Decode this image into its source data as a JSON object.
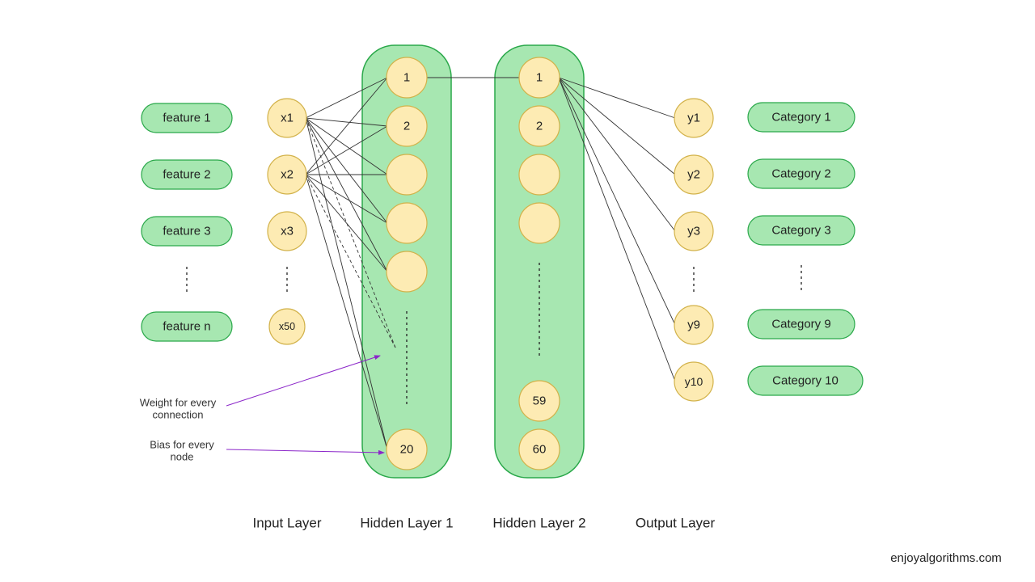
{
  "features": [
    "feature 1",
    "feature 2",
    "feature 3",
    "feature n"
  ],
  "inputs": [
    "x1",
    "x2",
    "x3",
    "x50"
  ],
  "hidden1_nodes": [
    "1",
    "2",
    "",
    "",
    "",
    "20"
  ],
  "hidden2_nodes": [
    "1",
    "2",
    "",
    "",
    "59",
    "60"
  ],
  "outputs": [
    "y1",
    "y2",
    "y3",
    "y9",
    "y10"
  ],
  "categories": [
    "Category 1",
    "Category 2",
    "Category 3",
    "Category 9",
    "Category 10"
  ],
  "captions": {
    "input": "Input Layer",
    "hidden1": "Hidden Layer 1",
    "hidden2": "Hidden Layer 2",
    "output": "Output Layer"
  },
  "notes": {
    "weight": "Weight for every\nconnection",
    "bias": "Bias for every\nnode"
  },
  "brand": {
    "pre": "enjoy",
    "post": "algorithms.com"
  }
}
